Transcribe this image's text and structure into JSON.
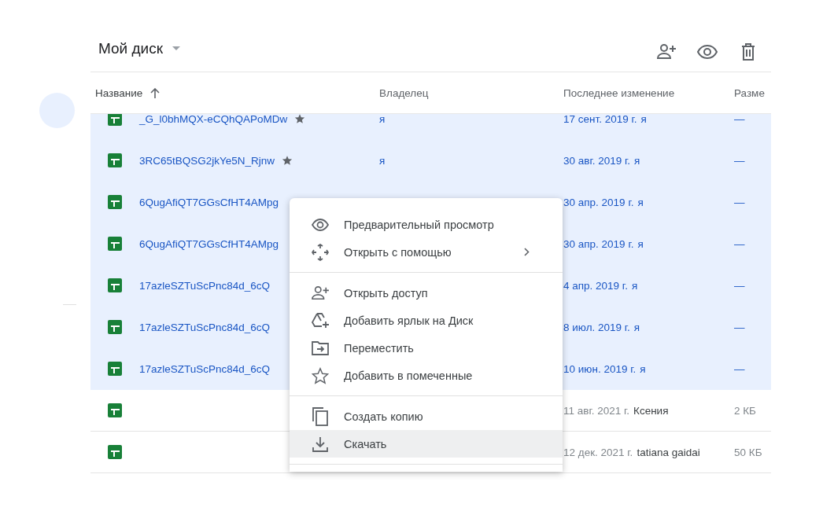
{
  "header": {
    "title": "Мой диск"
  },
  "columns": [
    {
      "label": "Название",
      "sorted": true
    },
    {
      "label": "Владелец",
      "sorted": false
    },
    {
      "label": "Последнее изменение",
      "sorted": false
    },
    {
      "label": "Разме",
      "sorted": false
    }
  ],
  "rows": [
    {
      "name": "_G_l0bhMQX-eCQhQAPoMDw",
      "starred": true,
      "owner": "я",
      "date": "17 сент. 2019 г.",
      "by": "я",
      "size": "—",
      "selected": true
    },
    {
      "name": "3RC65tBQSG2jkYe5N_Rjnw",
      "starred": true,
      "owner": "я",
      "date": "30 авг. 2019 г.",
      "by": "я",
      "size": "—",
      "selected": true
    },
    {
      "name": "6QugAfiQT7GGsCfHT4AMpg",
      "starred": false,
      "date": "30 апр. 2019 г.",
      "by": "я",
      "size": "—",
      "selected": true
    },
    {
      "name": "6QugAfiQT7GGsCfHT4AMpg",
      "starred": false,
      "date": "30 апр. 2019 г.",
      "by": "я",
      "size": "—",
      "selected": true
    },
    {
      "name": "17azleSZTuScPnc84d_6cQ",
      "starred": false,
      "date": "4 апр. 2019 г.",
      "by": "я",
      "size": "—",
      "selected": true
    },
    {
      "name": "17azleSZTuScPnc84d_6cQ",
      "starred": false,
      "date": "8 июл. 2019 г.",
      "by": "я",
      "size": "—",
      "selected": true
    },
    {
      "name": "17azleSZTuScPnc84d_6cQ",
      "starred": false,
      "date": "10 июн. 2019 г.",
      "by": "я",
      "size": "—",
      "selected": true
    },
    {
      "starred": false,
      "date": "11 авг. 2021 г.",
      "by": "Ксения",
      "size": "2 КБ",
      "selected": false
    },
    {
      "starred": false,
      "date": "12 дек. 2021 г.",
      "by": "tatiana gaidai",
      "size": "50 КБ",
      "selected": false
    }
  ],
  "context_menu": {
    "groups": [
      [
        {
          "kind": "eye",
          "label": "Предварительный просмотр",
          "submenu": false,
          "selected": false
        },
        {
          "kind": "move",
          "label": "Открыть с помощью",
          "submenu": true,
          "selected": false
        }
      ],
      [
        {
          "kind": "share",
          "label": "Открыть доступ",
          "submenu": false,
          "selected": false
        },
        {
          "kind": "shortcut",
          "label": "Добавить ярлык на Диск",
          "submenu": false,
          "selected": false
        },
        {
          "kind": "folder",
          "label": "Переместить",
          "submenu": false,
          "selected": false
        },
        {
          "kind": "star",
          "label": "Добавить в помеченные",
          "submenu": false,
          "selected": false
        }
      ],
      [
        {
          "kind": "copy",
          "label": "Создать копию",
          "submenu": false,
          "selected": false
        },
        {
          "kind": "download",
          "label": "Скачать",
          "submenu": false,
          "selected": true
        }
      ]
    ]
  }
}
